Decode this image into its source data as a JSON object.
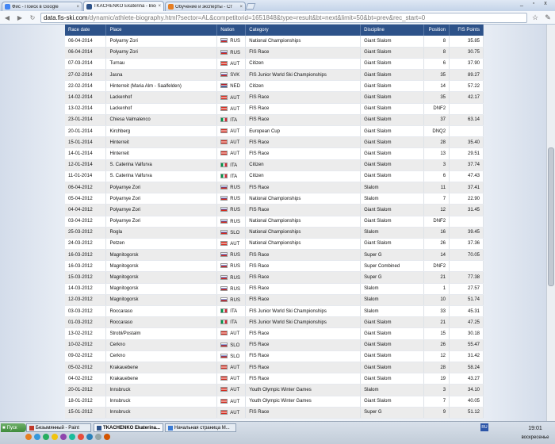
{
  "browser": {
    "tabs": [
      {
        "label": "Фис - Поиск в Google",
        "icon_color": "#4285f4",
        "active": false
      },
      {
        "label": "TKACHENKO Ekaterina - Biog",
        "icon_color": "#2d5289",
        "active": true
      },
      {
        "label": "Обучение и эксперты - Ст",
        "icon_color": "#e67e22",
        "active": false
      }
    ],
    "url_host": "data.fis-ski.com",
    "url_path": "/dynamic/athlete-biography.html?sector=AL&competitorid=1651848&type=result&bt=next&limit=50&bt=prev&rec_start=0",
    "back_icon": "back-arrow-icon",
    "forward_icon": "forward-arrow-icon",
    "reload_icon": "reload-icon",
    "star_icon": "star-icon",
    "wrench_icon": "wrench-icon",
    "window_controls": [
      "_",
      "▫",
      "x"
    ]
  },
  "table": {
    "headers": [
      "Race date",
      "Place",
      "Nation",
      "Category",
      "Discipline",
      "Position",
      "FIS Points"
    ],
    "flag_colors": {
      "RUS": [
        "#ffffff",
        "#2c4fb0",
        "#d52b1e"
      ],
      "AUT": [
        "#d52b1e",
        "#ffffff",
        "#d52b1e"
      ],
      "SVK": [
        "#ffffff",
        "#2c4fb0",
        "#d52b1e"
      ],
      "NED": [
        "#ae1c28",
        "#ffffff",
        "#21468b"
      ],
      "ITA": [
        "#009246",
        "#ffffff",
        "#ce2b37"
      ],
      "SLO": [
        "#ffffff",
        "#2c4fb0",
        "#d52b1e"
      ]
    },
    "rows": [
      {
        "date": "06-04-2014",
        "place": "Polyarny Zori",
        "nation": "RUS",
        "category": "National Championships",
        "discipline": "Giant Slalom",
        "position": "8",
        "points": "35.85"
      },
      {
        "date": "06-04-2014",
        "place": "Polyarny Zori",
        "nation": "RUS",
        "category": "FIS Race",
        "discipline": "Giant Slalom",
        "position": "8",
        "points": "30.75"
      },
      {
        "date": "07-03-2014",
        "place": "Turnau",
        "nation": "AUT",
        "category": "Citizen",
        "discipline": "Giant Slalom",
        "position": "6",
        "points": "37.90"
      },
      {
        "date": "27-02-2014",
        "place": "Jasna",
        "nation": "SVK",
        "category": "FIS Junior World Ski Championships",
        "discipline": "Giant Slalom",
        "position": "35",
        "points": "89.27"
      },
      {
        "date": "22-02-2014",
        "place": "Hinterreit (Maria Alm - Saalfelden)",
        "nation": "NED",
        "category": "Citizen",
        "discipline": "Giant Slalom",
        "position": "14",
        "points": "57.22"
      },
      {
        "date": "14-02-2014",
        "place": "Lackenhof",
        "nation": "AUT",
        "category": "FIS Race",
        "discipline": "Giant Slalom",
        "position": "35",
        "points": "42.17"
      },
      {
        "date": "13-02-2014",
        "place": "Lackenhof",
        "nation": "AUT",
        "category": "FIS Race",
        "discipline": "Giant Slalom",
        "position": "DNF2",
        "points": ""
      },
      {
        "date": "23-01-2014",
        "place": "Chiesa Valmalenco",
        "nation": "ITA",
        "category": "FIS Race",
        "discipline": "Giant Slalom",
        "position": "37",
        "points": "63.14"
      },
      {
        "date": "20-01-2014",
        "place": "Kirchberg",
        "nation": "AUT",
        "category": "European Cup",
        "discipline": "Giant Slalom",
        "position": "DNQ2",
        "points": ""
      },
      {
        "date": "15-01-2014",
        "place": "Hinterreit",
        "nation": "AUT",
        "category": "FIS Race",
        "discipline": "Giant Slalom",
        "position": "28",
        "points": "35.40"
      },
      {
        "date": "14-01-2014",
        "place": "Hinterreit",
        "nation": "AUT",
        "category": "FIS Race",
        "discipline": "Giant Slalom",
        "position": "13",
        "points": "29.51"
      },
      {
        "date": "12-01-2014",
        "place": "S. Caterina Valfurva",
        "nation": "ITA",
        "category": "Citizen",
        "discipline": "Giant Slalom",
        "position": "3",
        "points": "37.74"
      },
      {
        "date": "11-01-2014",
        "place": "S. Caterina Valfurva",
        "nation": "ITA",
        "category": "Citizen",
        "discipline": "Giant Slalom",
        "position": "6",
        "points": "47.43"
      },
      {
        "date": "06-04-2012",
        "place": "Polyarnye Zori",
        "nation": "RUS",
        "category": "FIS Race",
        "discipline": "Slalom",
        "position": "11",
        "points": "37.41"
      },
      {
        "date": "05-04-2012",
        "place": "Polyarnye Zori",
        "nation": "RUS",
        "category": "National Championships",
        "discipline": "Slalom",
        "position": "7",
        "points": "22.90"
      },
      {
        "date": "04-04-2012",
        "place": "Polyarnye Zori",
        "nation": "RUS",
        "category": "FIS Race",
        "discipline": "Giant Slalom",
        "position": "12",
        "points": "31.45"
      },
      {
        "date": "03-04-2012",
        "place": "Polyarnye Zori",
        "nation": "RUS",
        "category": "National Championships",
        "discipline": "Giant Slalom",
        "position": "DNF2",
        "points": ""
      },
      {
        "date": "25-03-2012",
        "place": "Rogla",
        "nation": "SLO",
        "category": "National Championships",
        "discipline": "Slalom",
        "position": "16",
        "points": "39.45"
      },
      {
        "date": "24-03-2012",
        "place": "Petzen",
        "nation": "AUT",
        "category": "National Championships",
        "discipline": "Giant Slalom",
        "position": "26",
        "points": "37.36"
      },
      {
        "date": "16-03-2012",
        "place": "Magnitogorsk",
        "nation": "RUS",
        "category": "FIS Race",
        "discipline": "Super G",
        "position": "14",
        "points": "70.05"
      },
      {
        "date": "16-03-2012",
        "place": "Magnitogorsk",
        "nation": "RUS",
        "category": "FIS Race",
        "discipline": "Super Combined",
        "position": "DNF2",
        "points": ""
      },
      {
        "date": "15-03-2012",
        "place": "Magnitogorsk",
        "nation": "RUS",
        "category": "FIS Race",
        "discipline": "Super G",
        "position": "21",
        "points": "77.38"
      },
      {
        "date": "14-03-2012",
        "place": "Magnitogorsk",
        "nation": "RUS",
        "category": "FIS Race",
        "discipline": "Slalom",
        "position": "1",
        "points": "27.57"
      },
      {
        "date": "12-03-2012",
        "place": "Magnitogorsk",
        "nation": "RUS",
        "category": "FIS Race",
        "discipline": "Slalom",
        "position": "10",
        "points": "51.74"
      },
      {
        "date": "03-03-2012",
        "place": "Roccaraso",
        "nation": "ITA",
        "category": "FIS Junior World Ski Championships",
        "discipline": "Slalom",
        "position": "33",
        "points": "45.31"
      },
      {
        "date": "01-03-2012",
        "place": "Roccaraso",
        "nation": "ITA",
        "category": "FIS Junior World Ski Championships",
        "discipline": "Giant Slalom",
        "position": "21",
        "points": "47.25"
      },
      {
        "date": "13-02-2012",
        "place": "Strobl/Postalm",
        "nation": "AUT",
        "category": "FIS Race",
        "discipline": "Giant Slalom",
        "position": "15",
        "points": "30.18"
      },
      {
        "date": "10-02-2012",
        "place": "Cerkno",
        "nation": "SLO",
        "category": "FIS Race",
        "discipline": "Giant Slalom",
        "position": "26",
        "points": "55.47"
      },
      {
        "date": "09-02-2012",
        "place": "Cerkno",
        "nation": "SLO",
        "category": "FIS Race",
        "discipline": "Giant Slalom",
        "position": "12",
        "points": "31.42"
      },
      {
        "date": "05-02-2012",
        "place": "Krakauebene",
        "nation": "AUT",
        "category": "FIS Race",
        "discipline": "Giant Slalom",
        "position": "28",
        "points": "58.24"
      },
      {
        "date": "04-02-2012",
        "place": "Krakauebene",
        "nation": "AUT",
        "category": "FIS Race",
        "discipline": "Giant Slalom",
        "position": "19",
        "points": "43.27"
      },
      {
        "date": "20-01-2012",
        "place": "Innsbruck",
        "nation": "AUT",
        "category": "Youth Olympic Winter Games",
        "discipline": "Slalom",
        "position": "3",
        "points": "34.10"
      },
      {
        "date": "18-01-2012",
        "place": "Innsbruck",
        "nation": "AUT",
        "category": "Youth Olympic Winter Games",
        "discipline": "Giant Slalom",
        "position": "7",
        "points": "40.05"
      },
      {
        "date": "15-01-2012",
        "place": "Innsbruck",
        "nation": "AUT",
        "category": "FIS Race",
        "discipline": "Super G",
        "position": "9",
        "points": "51.12"
      }
    ]
  },
  "taskbar": {
    "start_label": "Пуск",
    "buttons": [
      {
        "label": "Безымянный - Paint",
        "icon_color": "#c0392b",
        "active": false
      },
      {
        "label": "TKACHENKO Ekaterina...",
        "icon_color": "#2d5289",
        "active": true
      },
      {
        "label": "Начальная страница M...",
        "icon_color": "#3a7bd5",
        "active": false
      }
    ],
    "quicklaunch_colors": [
      "#e67e22",
      "#3498db",
      "#27ae60",
      "#f1c40f",
      "#8e44ad",
      "#1abc9c",
      "#e74c3c",
      "#2980b9",
      "#95a5a6",
      "#d35400"
    ],
    "lang": "RU",
    "time": "19:01",
    "day": "воскресенье"
  }
}
